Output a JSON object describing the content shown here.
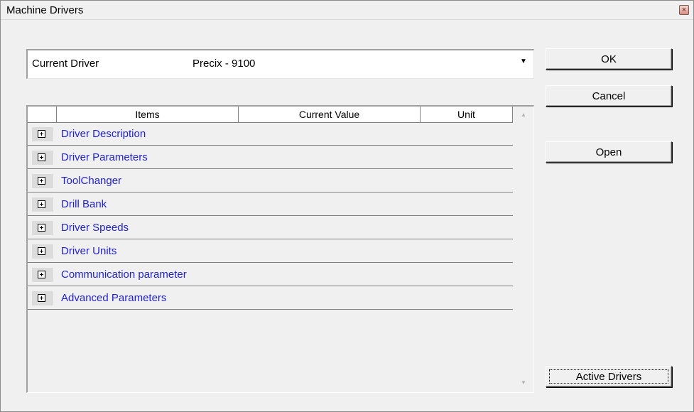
{
  "window": {
    "title": "Machine Drivers",
    "close_glyph": "×"
  },
  "current_driver": {
    "label": "Current Driver",
    "value": "Precix  -  9100",
    "dropdown_glyph": "▼"
  },
  "buttons": {
    "ok": "OK",
    "cancel": "Cancel",
    "open": "Open",
    "active_drivers": "Active Drivers"
  },
  "grid": {
    "columns": [
      "",
      "Items",
      "Current Value",
      "Unit"
    ],
    "rows": [
      {
        "label": "Driver Description"
      },
      {
        "label": "Driver Parameters"
      },
      {
        "label": "ToolChanger"
      },
      {
        "label": "Drill Bank"
      },
      {
        "label": "Driver Speeds"
      },
      {
        "label": "Driver Units"
      },
      {
        "label": "Communication parameter"
      },
      {
        "label": "Advanced Parameters"
      }
    ],
    "scroll_up_glyph": "▲",
    "scroll_down_glyph": "▼"
  },
  "colors": {
    "row_label": "#1f1fd6",
    "background": "#f0f0f0"
  },
  "icons": {
    "expander": "plus-box-icon",
    "close": "close-icon",
    "dropdown": "dropdown-arrow-icon"
  }
}
